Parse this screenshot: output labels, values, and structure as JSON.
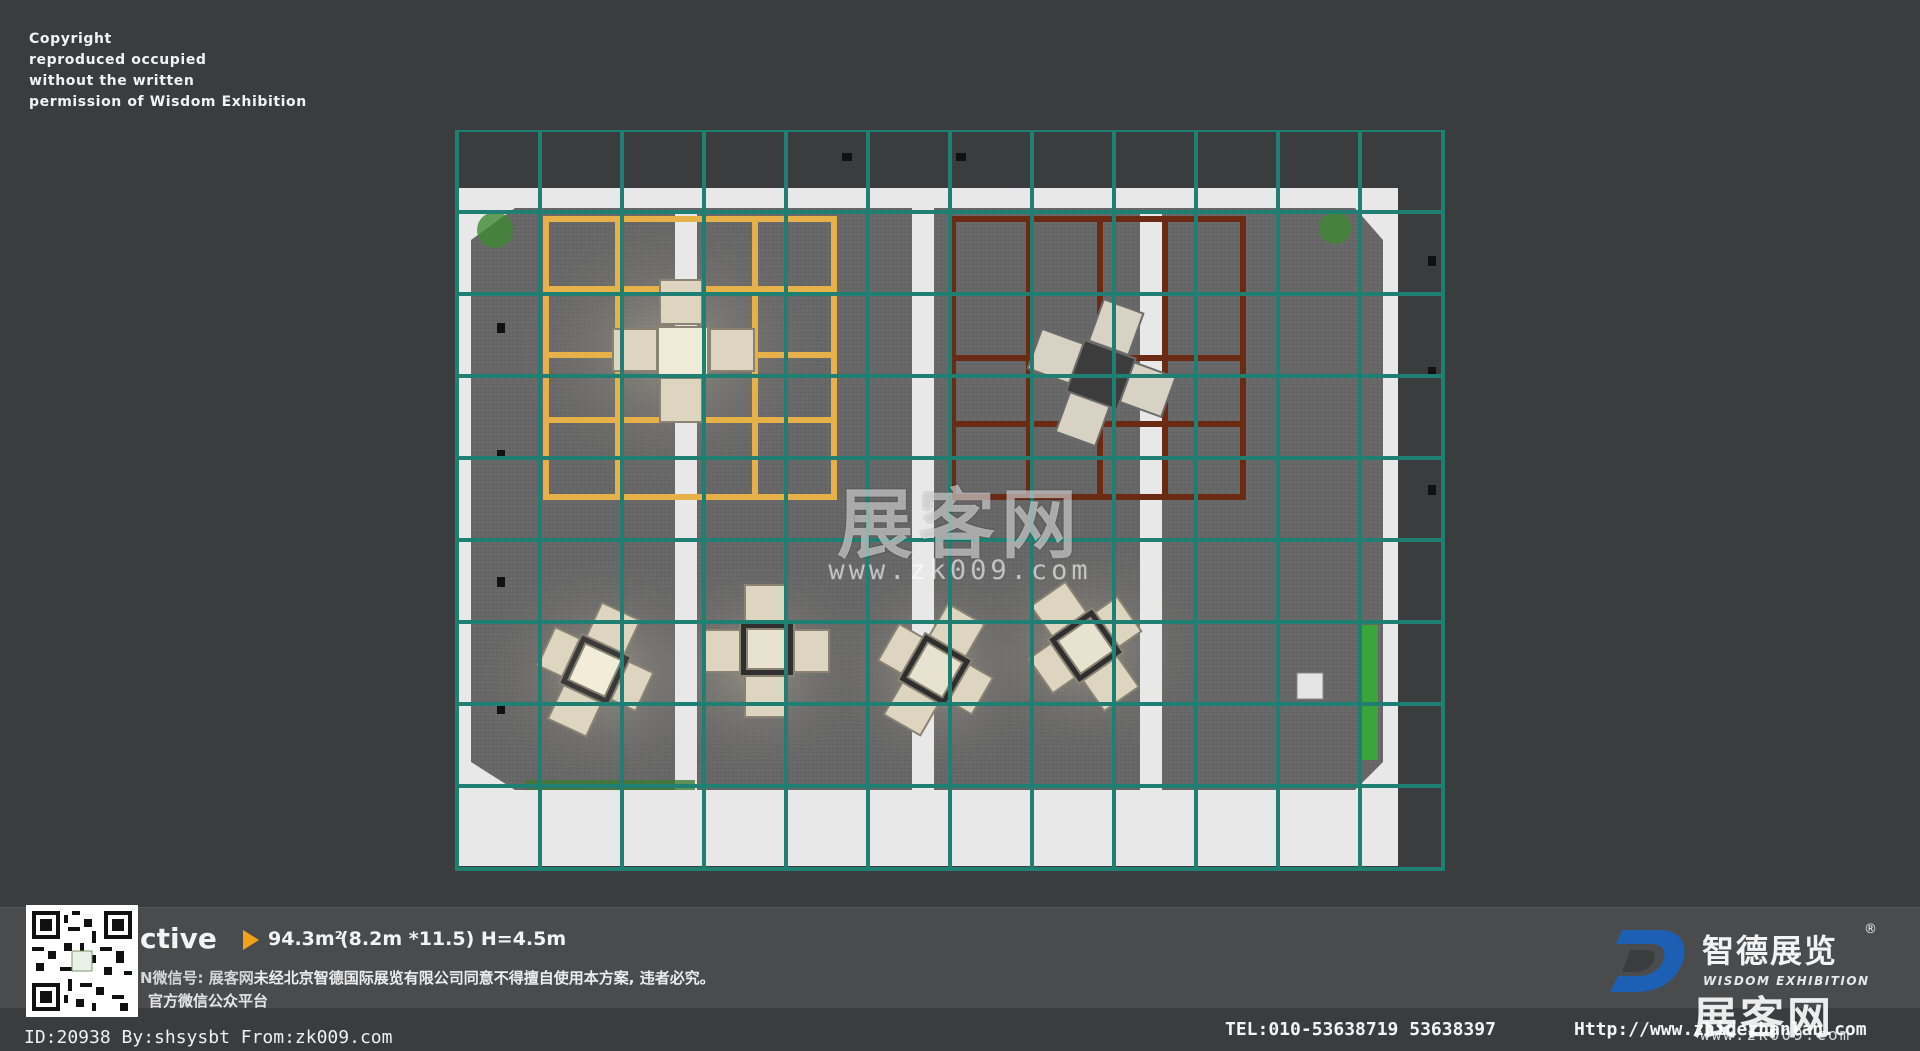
{
  "copyright_lines": [
    "Copyright",
    "reproduced occupied",
    "without the written",
    "permission of Wisdom Exhibition"
  ],
  "watermark": {
    "title": "展客网",
    "url": "www.zk009.com"
  },
  "info": {
    "title_word": "ctive",
    "area": "94.3m²",
    "dims": "(8.2m  *11.5) H=4.5m",
    "wechat_label": "N微信号: 展客网",
    "notice": "未经北京智德国际展览有限公司同意不得擅自使用本方案, 违者必究。",
    "wechat_platform": "官方微信公众平台"
  },
  "brand": {
    "name_cn": "智德展览",
    "reg_mark": "®",
    "name_en": "WISDOM EXHIBITION",
    "accent": "#1d5fb3"
  },
  "contact": {
    "tel": "TEL:010-53638719  53638397",
    "url": "Http://www.zhidezhanlan.com"
  },
  "id_line": "ID:20938 By:shsysbt From:zk009.com",
  "colors": {
    "background": "#3b3c3e",
    "grid": "#1e7f72",
    "carpet": "#6a6a6a",
    "wall": "#e6e6e6",
    "gold_frame": "#e7b14a",
    "dark_frame": "#6b2a14",
    "plant_green": "#3aa53a"
  }
}
